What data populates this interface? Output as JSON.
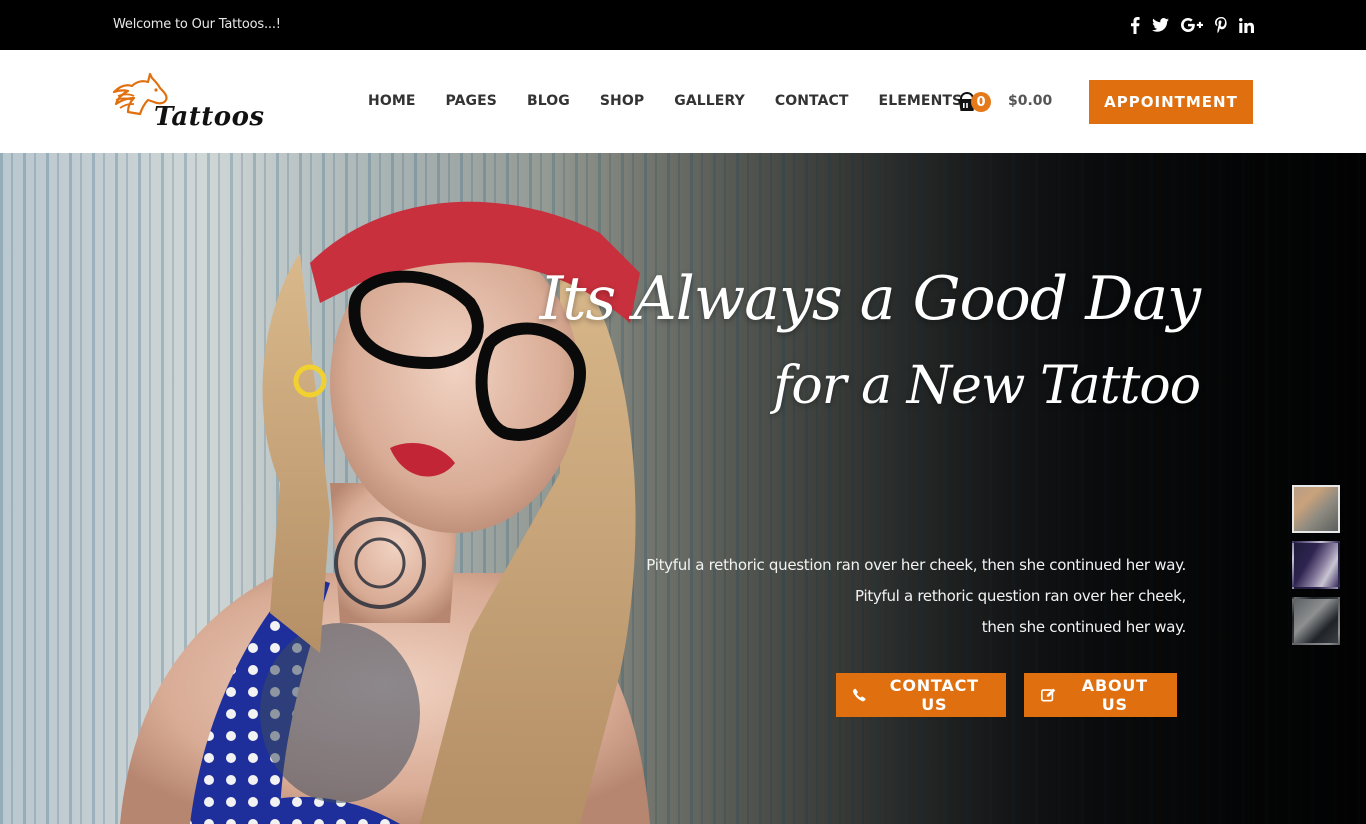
{
  "topbar": {
    "welcome": "Welcome to Our Tattoos...!",
    "social": [
      {
        "name": "facebook",
        "icon": "facebook-icon"
      },
      {
        "name": "twitter",
        "icon": "twitter-icon"
      },
      {
        "name": "google-plus",
        "icon": "google-plus-icon"
      },
      {
        "name": "pinterest",
        "icon": "pinterest-icon"
      },
      {
        "name": "linkedin",
        "icon": "linkedin-icon"
      }
    ]
  },
  "header": {
    "logo_text": "Tattoos",
    "logo_icon": "horse-head-icon",
    "nav": [
      {
        "label": "HOME"
      },
      {
        "label": "PAGES"
      },
      {
        "label": "BLOG"
      },
      {
        "label": "SHOP"
      },
      {
        "label": "GALLERY"
      },
      {
        "label": "CONTACT"
      },
      {
        "label": "ELEMENTS"
      }
    ],
    "cart": {
      "icon": "basket-icon",
      "count": "0",
      "total": "$0.00"
    },
    "appointment_label": "APPOINTMENT"
  },
  "hero": {
    "title_line1": "Its Always a Good Day",
    "title_line2": "for a New Tattoo",
    "text_lines": [
      "Pityful a rethoric question ran over her cheek, then she continued her way.",
      "Pityful a rethoric question ran over her cheek,",
      "then she continued her way."
    ],
    "buttons": [
      {
        "label": "CONTACT US",
        "icon": "phone-icon"
      },
      {
        "label": "ABOUT US",
        "icon": "edit-icon"
      }
    ],
    "slides": [
      {
        "label": "slide-1",
        "active": true
      },
      {
        "label": "slide-2",
        "active": false
      },
      {
        "label": "slide-3",
        "active": false
      }
    ]
  },
  "colors": {
    "accent": "#e0700f",
    "topbar_bg": "#000000",
    "header_bg": "#ffffff",
    "nav_text": "#333333"
  }
}
